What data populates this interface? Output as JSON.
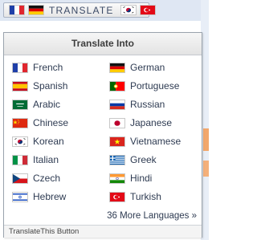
{
  "topbar": {
    "label": "TRANSLATE"
  },
  "panel": {
    "title": "Translate Into",
    "more_link": "36 More Languages »",
    "footer": "TranslateThis Button"
  },
  "languages": [
    {
      "name": "French",
      "icon": "france-flag-icon"
    },
    {
      "name": "German",
      "icon": "germany-flag-icon"
    },
    {
      "name": "Spanish",
      "icon": "spain-flag-icon"
    },
    {
      "name": "Portuguese",
      "icon": "portugal-flag-icon"
    },
    {
      "name": "Arabic",
      "icon": "saudi-arabia-flag-icon"
    },
    {
      "name": "Russian",
      "icon": "russia-flag-icon"
    },
    {
      "name": "Chinese",
      "icon": "china-flag-icon"
    },
    {
      "name": "Japanese",
      "icon": "japan-flag-icon"
    },
    {
      "name": "Korean",
      "icon": "south-korea-flag-icon"
    },
    {
      "name": "Vietnamese",
      "icon": "vietnam-flag-icon"
    },
    {
      "name": "Italian",
      "icon": "italy-flag-icon"
    },
    {
      "name": "Greek",
      "icon": "greece-flag-icon"
    },
    {
      "name": "Czech",
      "icon": "czech-flag-icon"
    },
    {
      "name": "Hindi",
      "icon": "india-flag-icon"
    },
    {
      "name": "Hebrew",
      "icon": "israel-flag-icon"
    },
    {
      "name": "Turkish",
      "icon": "turkey-flag-icon"
    }
  ]
}
